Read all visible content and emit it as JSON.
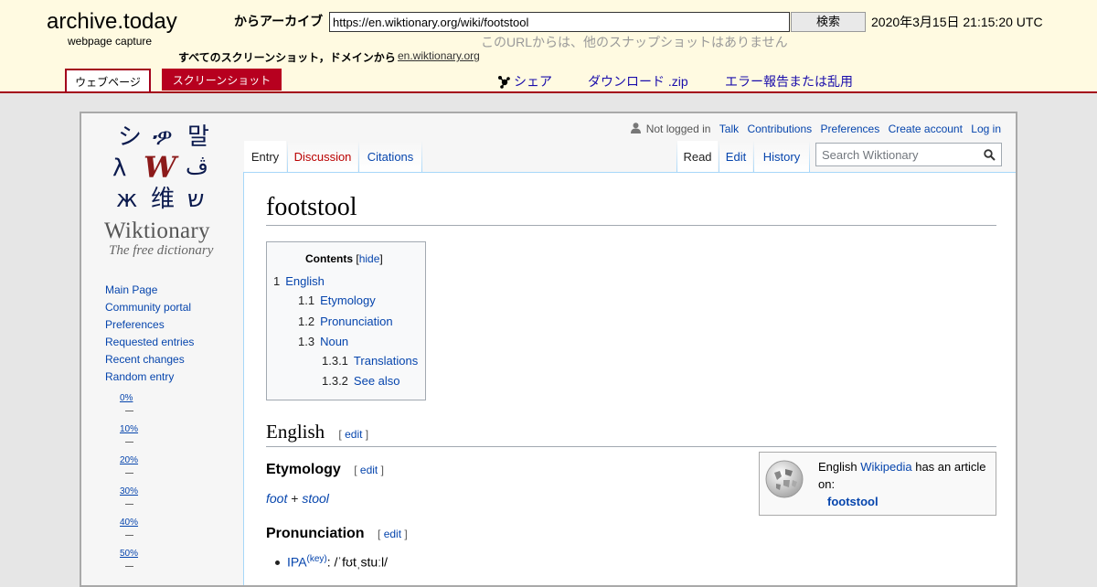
{
  "archive": {
    "brand": "archive.today",
    "brand_sub": "webpage capture",
    "from_label": "からアーカイブ",
    "url_value": "https://en.wiktionary.org/wiki/footstool",
    "search_label": "検索",
    "timestamp": "2020年3月15日 21:15:20 UTC",
    "no_snapshots": "このURLからは、他のスナップショットはありません",
    "all_screenshots": "すべてのスクリーンショット，ドメインから",
    "domain": "en.wiktionary.org",
    "tab_webpage": "ウェブページ",
    "tab_screenshot": "スクリーンショット",
    "share": "シェア",
    "download": "ダウンロード .zip",
    "report": "エラー報告または乱用"
  },
  "wiki": {
    "logo_title": "Wiktionary",
    "logo_tagline": "The free dictionary",
    "nav": [
      "Main Page",
      "Community portal",
      "Preferences",
      "Requested entries",
      "Recent changes",
      "Random entry"
    ],
    "ticks": [
      "0%",
      "10%",
      "20%",
      "30%",
      "40%",
      "50%"
    ],
    "personal": {
      "not_logged_in": "Not logged in",
      "links": [
        "Talk",
        "Contributions",
        "Preferences",
        "Create account",
        "Log in"
      ]
    },
    "tabs": {
      "entry": "Entry",
      "discussion": "Discussion",
      "citations": "Citations",
      "read": "Read",
      "edit": "Edit",
      "history": "History"
    },
    "search_placeholder": "Search Wiktionary",
    "title": "footstool",
    "toc": {
      "title": "Contents",
      "hide": "hide",
      "items": [
        {
          "num": "1",
          "text": "English"
        },
        {
          "num": "1.1",
          "text": "Etymology"
        },
        {
          "num": "1.2",
          "text": "Pronunciation"
        },
        {
          "num": "1.3",
          "text": "Noun"
        },
        {
          "num": "1.3.1",
          "text": "Translations"
        },
        {
          "num": "1.3.2",
          "text": "See also"
        }
      ]
    },
    "sections": {
      "english": "English",
      "etymology": "Etymology",
      "pronunciation": "Pronunciation",
      "edit": "edit"
    },
    "etymology": {
      "part1": "foot",
      "plus": " + ",
      "part2": "stool"
    },
    "pronunciation": {
      "ipa_label": "IPA",
      "key": "(key)",
      "ipa_value": ": /ˈfʊtˌstuːl/"
    },
    "wikipedia_box": {
      "text1": "English ",
      "link": "Wikipedia",
      "text2": " has an article on:",
      "term": "footstool"
    }
  }
}
